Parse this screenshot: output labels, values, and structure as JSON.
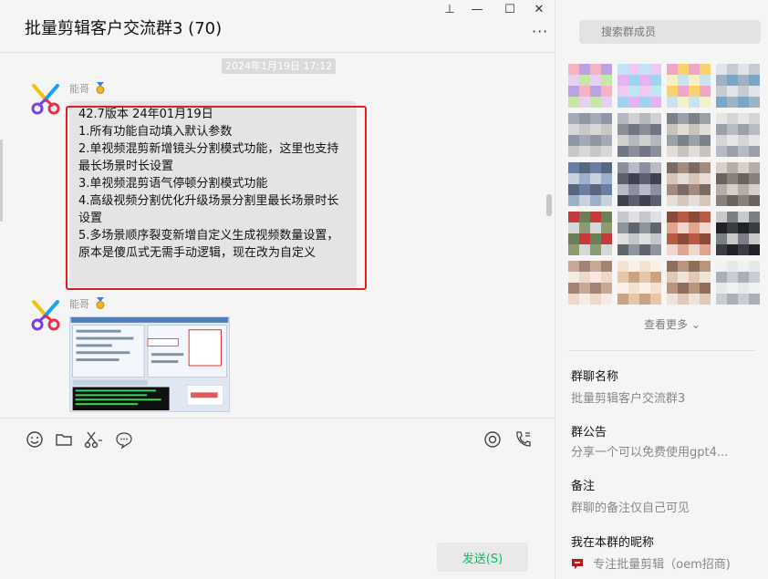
{
  "window": {
    "title": "批量剪辑客户交流群3 (70)",
    "pin_glyph": "⊥",
    "minimize_glyph": "—",
    "maximize_glyph": "☐",
    "close_glyph": "✕",
    "more_glyph": "···"
  },
  "messages": {
    "timestamp": "2024年1月19日 17:12",
    "items": [
      {
        "sender": "能哥",
        "lines": [
          "42.7版本   24年01月19日",
          "1.所有功能自动填入默认参数",
          "2.单视频混剪新增镜头分割模式功能，这里也支持最长场景时长设置",
          "3.单视频混剪语气停顿分割模式功能",
          "4.高级视频分割优化升级场景分割里最长场景时长设置",
          "5.多场景顺序裂变新增自定义生成视频数量设置，原本是傻瓜式无需手动逻辑，现在改为自定义"
        ]
      },
      {
        "sender": "能哥",
        "image": "software-screenshot-thumbnail"
      }
    ]
  },
  "composer": {
    "send_label": "发送(S)",
    "tools": [
      "emoji-icon",
      "folder-icon",
      "scissors-icon",
      "chat-bubble-icon",
      "live-icon",
      "call-icon"
    ]
  },
  "sidebar": {
    "search_placeholder": "搜索群成员",
    "view_more": "查看更多 ⌄",
    "group_name_label": "群聊名称",
    "group_name_value": "批量剪辑客户交流群3",
    "notice_label": "群公告",
    "notice_value": "分享一个可以免费使用gpt4...",
    "remark_label": "备注",
    "remark_value": "群聊的备注仅自己可见",
    "nickname_label": "我在本群的昵称",
    "nickname_value": "专注批量剪辑（oem招商)"
  },
  "colors": {
    "accent": "#07c160",
    "highlight_border": "#e02020",
    "bubble": "#e4e4e4"
  }
}
